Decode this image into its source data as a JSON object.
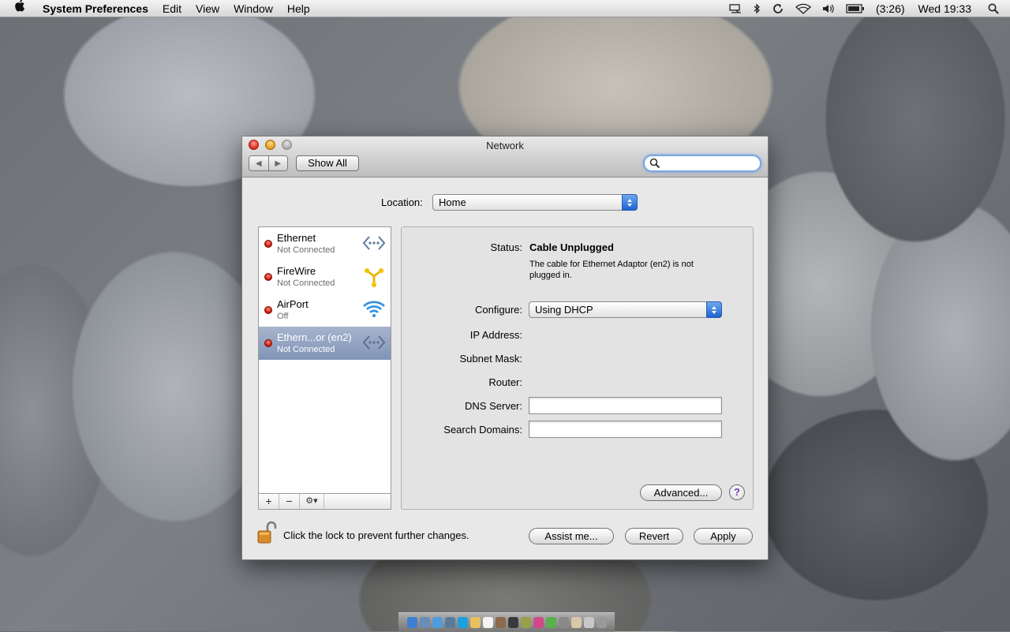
{
  "menubar": {
    "app_name": "System Preferences",
    "items": [
      "Edit",
      "View",
      "Window",
      "Help"
    ],
    "battery_time": "(3:26)",
    "clock": "Wed 19:33"
  },
  "window": {
    "title": "Network",
    "show_all": "Show All",
    "search_placeholder": ""
  },
  "location": {
    "label": "Location:",
    "value": "Home"
  },
  "services": [
    {
      "name": "Ethernet",
      "status": "Not Connected",
      "icon": "ethernet-icon",
      "selected": false
    },
    {
      "name": "FireWire",
      "status": "Not Connected",
      "icon": "firewire-icon",
      "selected": false
    },
    {
      "name": "AirPort",
      "status": "Off",
      "icon": "airport-icon",
      "selected": false
    },
    {
      "name": "Ethern...or (en2)",
      "status": "Not Connected",
      "icon": "ethernet-icon",
      "selected": true
    }
  ],
  "list_toolbar": {
    "add": "+",
    "remove": "−",
    "gear": "⚙▾"
  },
  "detail": {
    "status_label": "Status:",
    "status_value": "Cable Unplugged",
    "status_desc": "The cable for Ethernet Adaptor (en2) is not plugged in.",
    "configure_label": "Configure:",
    "configure_value": "Using DHCP",
    "ip_label": "IP Address:",
    "subnet_label": "Subnet Mask:",
    "router_label": "Router:",
    "dns_label": "DNS Server:",
    "dns_value": "",
    "search_domains_label": "Search Domains:",
    "search_domains_value": "",
    "advanced": "Advanced...",
    "help": "?"
  },
  "footer": {
    "lock_text": "Click the lock to prevent further changes.",
    "assist": "Assist me...",
    "revert": "Revert",
    "apply": "Apply"
  },
  "colors": {
    "selection": "#8fa0c0",
    "status_dot": "#d01a0c",
    "popup_accent": "#2b6fd6"
  }
}
